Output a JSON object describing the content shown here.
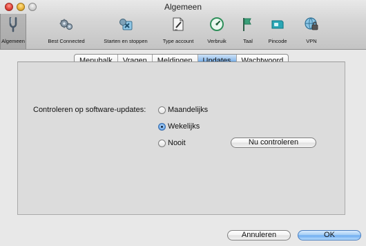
{
  "window": {
    "title": "Algemeen"
  },
  "toolbar": {
    "items": [
      {
        "label": "Algemeen",
        "icon": "tuning-fork-icon"
      },
      {
        "label": "Best Connected",
        "icon": "gears-icon"
      },
      {
        "label": "Starten en stoppen",
        "icon": "start-stop-icon"
      },
      {
        "label": "Type account",
        "icon": "account-document-icon"
      },
      {
        "label": "Verbruik",
        "icon": "usage-meter-icon"
      },
      {
        "label": "Taal",
        "icon": "flag-icon"
      },
      {
        "label": "Pincode",
        "icon": "sim-card-icon"
      },
      {
        "label": "VPN",
        "icon": "vpn-globe-icon"
      }
    ],
    "selected": "Algemeen"
  },
  "tabs": [
    "Menubalk",
    "Vragen",
    "Meldingen",
    "Updates",
    "Wachtwoord"
  ],
  "active_tab": "Updates",
  "updates": {
    "label": "Controleren op software-updates:",
    "options": [
      "Maandelijks",
      "Wekelijks",
      "Nooit"
    ],
    "selected": "Wekelijks",
    "check_now_label": "Nu controleren"
  },
  "footer": {
    "cancel_label": "Annuleren",
    "ok_label": "OK"
  },
  "colors": {
    "accent": "#6aaaf0",
    "toolbar_selected": "#a9a9a9"
  }
}
